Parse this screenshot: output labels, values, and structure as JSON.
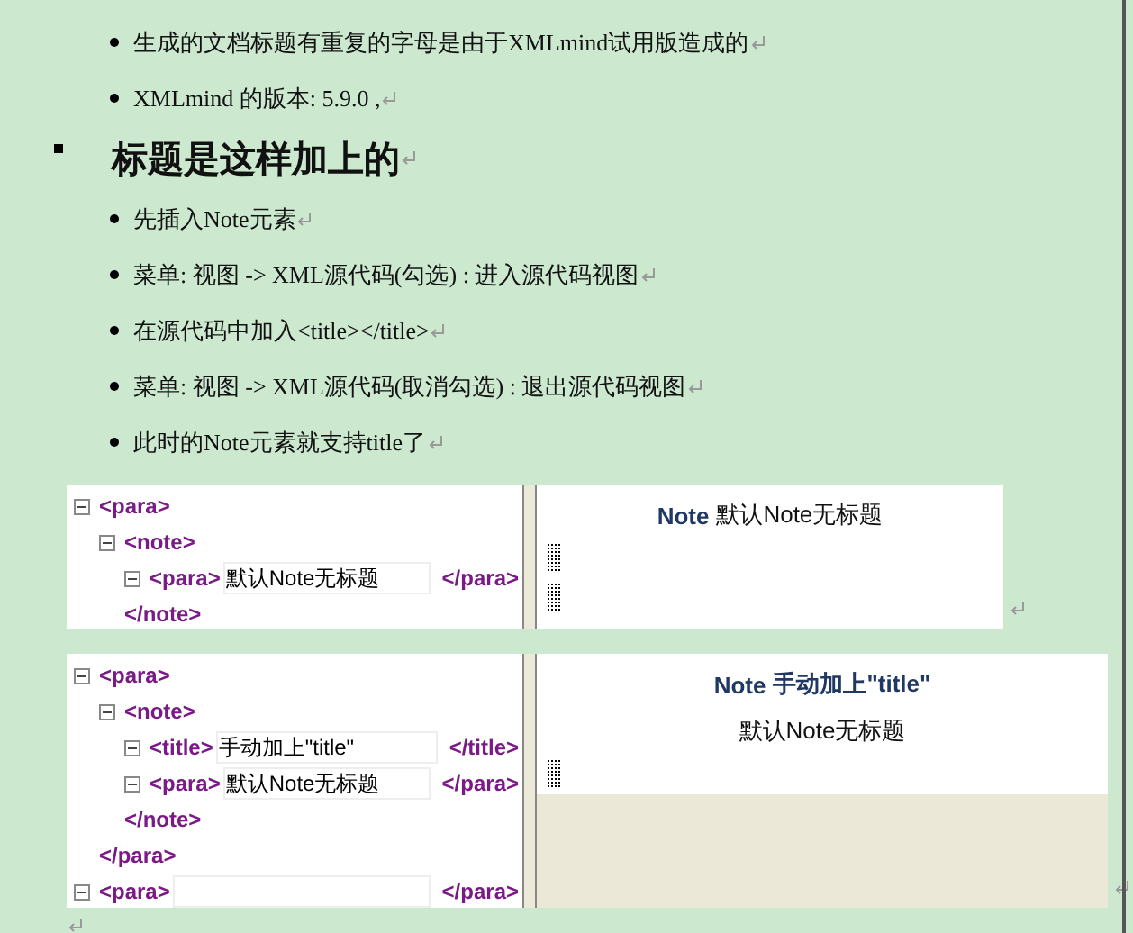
{
  "intro_bullets": [
    "生成的文档标题有重复的字母是由于XMLmind试用版造成的",
    "XMLmind  的版本: 5.9.0 ,"
  ],
  "heading": "标题是这样加上的",
  "steps": [
    "先插入Note元素",
    "菜单: 视图  -> XML源代码(勾选) : 进入源代码视图",
    "在源代码中加入<title></title>",
    "菜单: 视图  -> XML源代码(取消勾选) : 退出源代码视图",
    "此时的Note元素就支持title了"
  ],
  "screenshots": [
    {
      "tree": [
        {
          "open": "<para>",
          "expanded": true,
          "children": [
            {
              "open": "<note>",
              "expanded": true,
              "close": "</note>",
              "children": [
                {
                  "open": "<para>",
                  "expanded": true,
                  "field": true,
                  "value": "默认Note无标题",
                  "close": "</para>"
                }
              ]
            }
          ]
        }
      ],
      "preview": [
        {
          "kind": "note",
          "label": "Note",
          "text": "默认Note无标题"
        },
        {
          "kind": "grip"
        },
        {
          "kind": "grip"
        }
      ]
    },
    {
      "tree": [
        {
          "open": "<para>",
          "expanded": true,
          "close": "</para>",
          "children": [
            {
              "open": "<note>",
              "expanded": true,
              "close": "</note>",
              "children": [
                {
                  "open": "<title>",
                  "expanded": true,
                  "field": true,
                  "value": "手动加上\"title\"",
                  "close": "</title>"
                },
                {
                  "open": "<para>",
                  "expanded": true,
                  "field": true,
                  "value": "默认Note无标题",
                  "close": "</para>"
                }
              ]
            }
          ]
        },
        {
          "open": "<para>",
          "expanded": true,
          "field": true,
          "close": "</para>"
        }
      ],
      "preview": [
        {
          "kind": "note-titled",
          "label": "Note",
          "title": "手动加上\"title\"",
          "text": "默认Note无标题"
        },
        {
          "kind": "grip"
        },
        {
          "kind": "empty-area"
        }
      ]
    }
  ]
}
